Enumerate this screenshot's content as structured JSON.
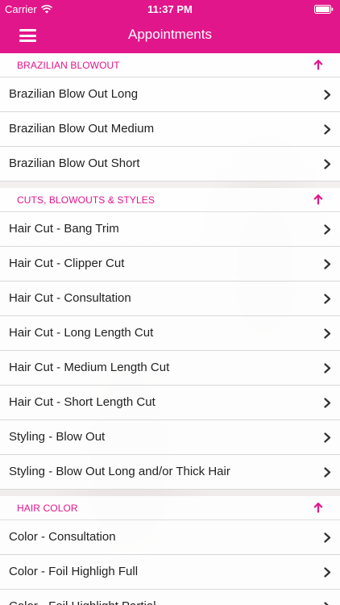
{
  "status_bar": {
    "carrier": "Carrier",
    "time": "11:37 PM",
    "wifi_icon": "wifi-icon",
    "battery_icon": "battery-icon"
  },
  "nav": {
    "title": "Appointments",
    "menu_icon": "hamburger-menu-icon"
  },
  "colors": {
    "accent": "#e2168b",
    "text": "#222222",
    "divider": "#d8d8d8"
  },
  "sections": [
    {
      "title": "BRAZILIAN BLOWOUT",
      "items": [
        "Brazilian Blow Out Long",
        "Brazilian Blow Out Medium",
        "Brazilian Blow Out Short"
      ]
    },
    {
      "title": "CUTS, BLOWOUTS & STYLES",
      "items": [
        "Hair Cut - Bang Trim",
        "Hair Cut - Clipper Cut",
        "Hair Cut - Consultation",
        "Hair Cut - Long Length Cut",
        "Hair Cut - Medium Length Cut",
        "Hair Cut - Short Length Cut",
        "Styling - Blow Out",
        "Styling - Blow Out Long and/or Thick Hair"
      ]
    },
    {
      "title": "HAIR COLOR",
      "items": [
        "Color - Consultation",
        "Color - Foil Highligh Full",
        "Color - Foil Highlight Partial"
      ]
    }
  ]
}
